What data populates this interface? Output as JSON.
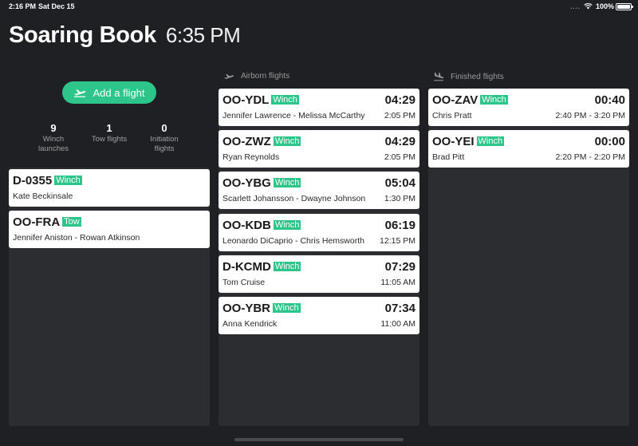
{
  "statusbar": {
    "time": "2:16 PM",
    "date": "Sat Dec 15",
    "signal": "....",
    "battery": "100%"
  },
  "header": {
    "title": "Soaring Book",
    "clock": "6:35 PM"
  },
  "add_flight": {
    "label": "Add a flight"
  },
  "stats": [
    {
      "value": "9",
      "label_line1": "Winch",
      "label_line2": "launches"
    },
    {
      "value": "1",
      "label_line1": "Tow flights",
      "label_line2": ""
    },
    {
      "value": "0",
      "label_line1": "Initiation",
      "label_line2": "flights"
    }
  ],
  "columns": {
    "airborn_label": "Airborn flights",
    "finished_label": "Finished flights"
  },
  "pending": [
    {
      "reg": "D-0355",
      "type": "Winch",
      "pilots": "Kate Beckinsale"
    },
    {
      "reg": "OO-FRA",
      "type": "Tow",
      "pilots": "Jennifer Aniston - Rowan Atkinson"
    }
  ],
  "airborn": [
    {
      "reg": "OO-YDL",
      "type": "Winch",
      "duration": "04:29",
      "pilots": "Jennifer Lawrence - Melissa McCarthy",
      "time": "2:05 PM"
    },
    {
      "reg": "OO-ZWZ",
      "type": "Winch",
      "duration": "04:29",
      "pilots": "Ryan Reynolds",
      "time": "2:05 PM"
    },
    {
      "reg": "OO-YBG",
      "type": "Winch",
      "duration": "05:04",
      "pilots": "Scarlett Johansson - Dwayne Johnson",
      "time": "1:30 PM"
    },
    {
      "reg": "OO-KDB",
      "type": "Winch",
      "duration": "06:19",
      "pilots": "Leonardo DiCaprio - Chris Hemsworth",
      "time": "12:15 PM"
    },
    {
      "reg": "D-KCMD",
      "type": "Winch",
      "duration": "07:29",
      "pilots": "Tom Cruise",
      "time": "11:05 AM"
    },
    {
      "reg": "OO-YBR",
      "type": "Winch",
      "duration": "07:34",
      "pilots": "Anna Kendrick",
      "time": "11:00 AM"
    }
  ],
  "finished": [
    {
      "reg": "OO-ZAV",
      "type": "Winch",
      "duration": "00:40",
      "pilots": "Chris Pratt",
      "time": "2:40 PM - 3:20 PM"
    },
    {
      "reg": "OO-YEI",
      "type": "Winch",
      "duration": "00:00",
      "pilots": "Brad Pitt",
      "time": "2:20 PM - 2:20 PM"
    }
  ]
}
